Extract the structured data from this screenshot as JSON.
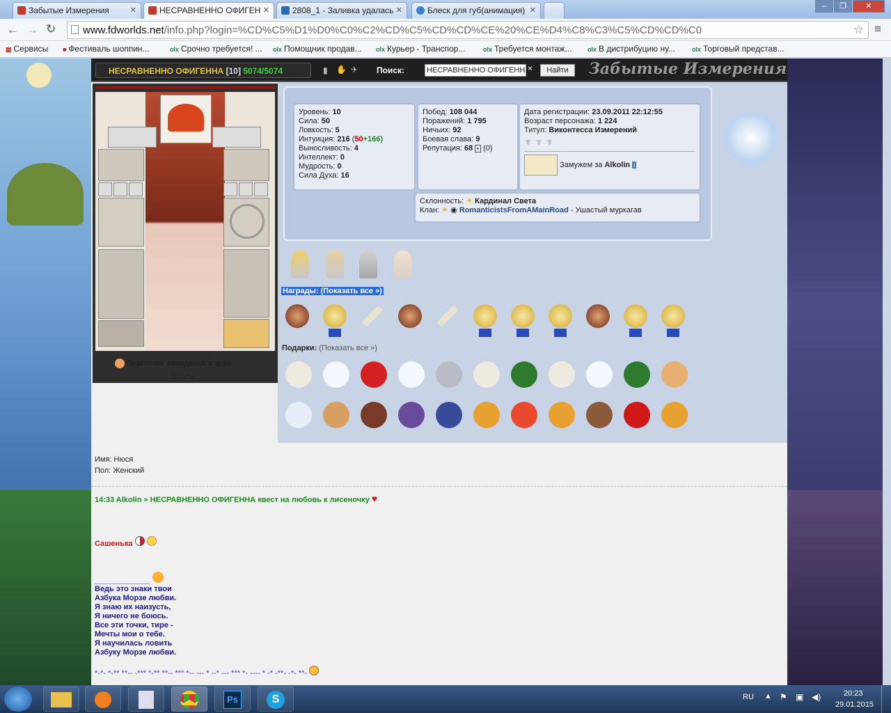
{
  "tabs": [
    {
      "title": "Забытые Измерения",
      "fav": "#c23a2a"
    },
    {
      "title": "НЕСРАВНЕННО ОФИГЕН",
      "fav": "#c23a2a"
    },
    {
      "title": "2808_1 - Заливка удалась",
      "fav": "#2a6ab0"
    },
    {
      "title": "Блеск для губ(анимация)",
      "fav": "#3a7fd0"
    }
  ],
  "omnibox": {
    "host": "www.fdworlds.net",
    "path": "/info.php?login=%CD%C5%D1%D0%C0%C2%CD%C5%CD%CD%CE%20%CE%D4%C8%C3%C5%CD%CD%C0"
  },
  "bookmarks": [
    {
      "label": "Сервисы",
      "icon": "apps-icon"
    },
    {
      "label": "Фестиваль шоппин...",
      "icon": "gift-icon"
    },
    {
      "label": "Срочно требуется! ...",
      "icon": "olx-icon"
    },
    {
      "label": "Помощник продав...",
      "icon": "olx-icon"
    },
    {
      "label": "Курьер - Транспор...",
      "icon": "olx-icon"
    },
    {
      "label": "Требуется монтаж...",
      "icon": "olx-icon"
    },
    {
      "label": "В дистрибуцию ну...",
      "icon": "olx-icon"
    },
    {
      "label": "Торговый представ...",
      "icon": "olx-icon"
    }
  ],
  "topbar": {
    "name": "НЕСРАВНЕННО ОФИГЕННА",
    "level": "[10]",
    "hp": "5074/5074",
    "search_label": "Поиск:",
    "search_value": "НЕСРАВНЕННО ОФИГЕННА",
    "search_button": "Найти",
    "logo": "Забытые Измерения"
  },
  "stats_left": [
    {
      "k": "Уровень:",
      "v": "10"
    },
    {
      "k": "Сила:",
      "v": "50"
    },
    {
      "k": "Ловкость:",
      "v": "5"
    },
    {
      "k": "Выносливость:",
      "v": "4"
    },
    {
      "k": "Интеллект:",
      "v": "0"
    },
    {
      "k": "Мудрость:",
      "v": "0"
    },
    {
      "k": "Сила Духа:",
      "v": "16"
    }
  ],
  "intuition": {
    "k": "Интуиция:",
    "v": "216",
    "a": "50",
    "b": "+166"
  },
  "stats_mid": [
    {
      "k": "Побед:",
      "v": "108 044"
    },
    {
      "k": "Поражений:",
      "v": "1 795"
    },
    {
      "k": "Ничьих:",
      "v": "92"
    },
    {
      "k": "Боевая слава:",
      "v": "9"
    }
  ],
  "reputation": {
    "k": "Репутация:",
    "v": "68",
    "extra": "(0)"
  },
  "stats_right": {
    "reg_k": "Дата регистрации:",
    "reg_v": "23.09.2011 22:12:55",
    "age_k": "Возраст персонажа:",
    "age_v": "1 224",
    "title_k": "Титул:",
    "title_v": "Виконтесса Измерений",
    "married": "Замужем за",
    "spouse": "Alkolin"
  },
  "align": {
    "k": "Склонность:",
    "v": "Кардинал Света",
    "clan_k": "Клан:",
    "clan_v": "RomanticistsFromAMainRoad",
    "clan_rank": " - Ушастый муркагав"
  },
  "status": {
    "online": "Персонаж находится в игре",
    "location": "Шахты"
  },
  "awards_label": "Награды:",
  "awards_link": "(Показать все »)",
  "gifts_label": "Подарки:",
  "gifts_link": "(Показать все »)",
  "info": {
    "name_k": "Имя:",
    "name_v": "Нюся",
    "sex_k": "Пол:",
    "sex_v": "Женский"
  },
  "chat": {
    "line1": "14:33 Alkolin » НЕСРАВНЕННО ОФИГЕННА квест на любовь к лисеночку",
    "nick": "Сашенька",
    "underline": "_____________",
    "poem": [
      "Ведь это знаки твои",
      "Азбука Морзе любви.",
      "Я знаю их наизусть,",
      "Я ничего не боюсь.",
      "Все эти точки, тире -",
      "Мечты мои о тебе.",
      "Я научилась ловить",
      "Азбуку Морзе любви."
    ],
    "morse": "*-*- *-** **-- -*** *-** **-- *** *-- --- * --* --- *** *- ---- * -* -**- -*- **-"
  },
  "taskbar": {
    "lang": "RU",
    "time": "20:23",
    "date": "29.01.2015"
  }
}
